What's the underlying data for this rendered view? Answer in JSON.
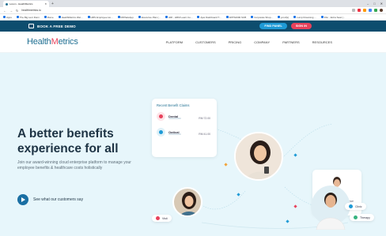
{
  "browser": {
    "tab_title": "Lorem - HealthMetrics",
    "url": "healthmetrics.io",
    "bookmarks": [
      "Apps",
      "The Big Lent Rumi",
      "Rome",
      "HealthMetrics Wel...",
      "HMS Employee Ho...",
      "MWhatsApp",
      "Executive Plan (...",
      "HRI - HRM Learn Co...",
      "Ajax Dashboard T...",
      "APPS2000 SUB",
      "Corporate Shop...",
      "yoruf(s)",
      "Lump Dreaming ...",
      "Kbn - Extra Seat (..."
    ]
  },
  "topbar": {
    "demo_label": "BOOK A FREE DEMO",
    "find_button": "FIND PANEL",
    "sign_button": "SIGN IN"
  },
  "nav": {
    "logo_prefix": "Health",
    "logo_m": "M",
    "logo_suffix": "etrics",
    "items": [
      "PLATFORM",
      "CUSTOMERS",
      "PRICING",
      "COMPANY",
      "PARTNERS",
      "RESOURCES"
    ]
  },
  "hero": {
    "headline_1": "A better benefits",
    "headline_2": "experience for all",
    "subtext": "Join our award-winning cloud enterprise platform to manage your employee benefits & healthcare costs holistically",
    "cta": "See what our customers say"
  },
  "claims_card": {
    "title": "Recent Benefit Claims",
    "items": [
      {
        "name": "Dental",
        "amount": "RM 72.00"
      },
      {
        "name": "Optical",
        "amount": "RM 41.00"
      }
    ]
  },
  "employee_card": {
    "text": "This annual benefits balance",
    "amount": "RM 960"
  },
  "pills": {
    "clinic": "Clinic",
    "approved": "Approved",
    "therapy": "Therapy",
    "visit": "Visit"
  },
  "colors": {
    "accent": "#e8415b",
    "brand": "#1f6f92",
    "hero_bg": "#e7f6fb"
  }
}
